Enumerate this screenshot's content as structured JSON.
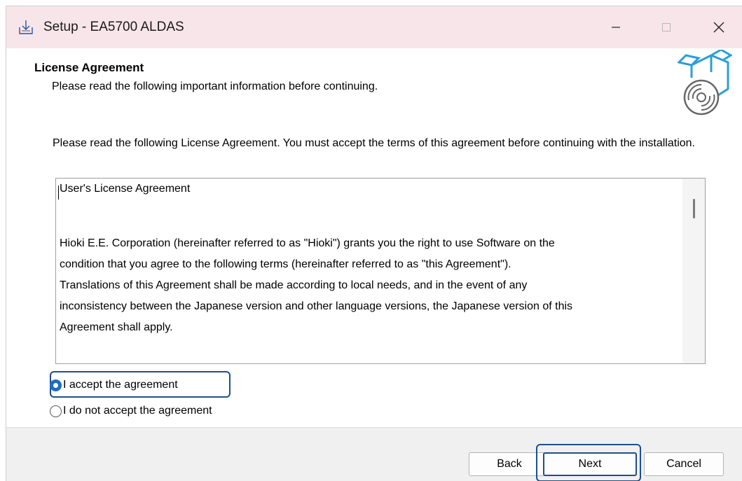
{
  "window": {
    "title": "Setup - EA5700 ALDAS"
  },
  "header": {
    "title": "License Agreement",
    "subtitle": "Please read the following important information before continuing."
  },
  "intro": "Please read the following License Agreement. You must accept the terms of this agreement before continuing with the installation.",
  "license": {
    "heading": "User's License Agreement",
    "body": [
      "Hioki E.E. Corporation (hereinafter referred to as \"Hioki\") grants you the right to use Software on the",
      "condition that you agree to the following terms (hereinafter referred to as \"this Agreement\").",
      "Translations of this Agreement shall be made according to local needs, and in the event of any",
      "inconsistency between the Japanese version and other language versions, the Japanese version of this",
      "Agreement shall apply."
    ]
  },
  "options": {
    "accept_label": "I accept the agreement",
    "decline_label": "I do not accept the agreement",
    "selected": "accept"
  },
  "buttons": {
    "back": "Back",
    "next": "Next",
    "cancel": "Cancel"
  },
  "colors": {
    "titlebar": "#f8e5ea",
    "accent": "#1c6fbf",
    "highlight": "#1f4f8c"
  }
}
